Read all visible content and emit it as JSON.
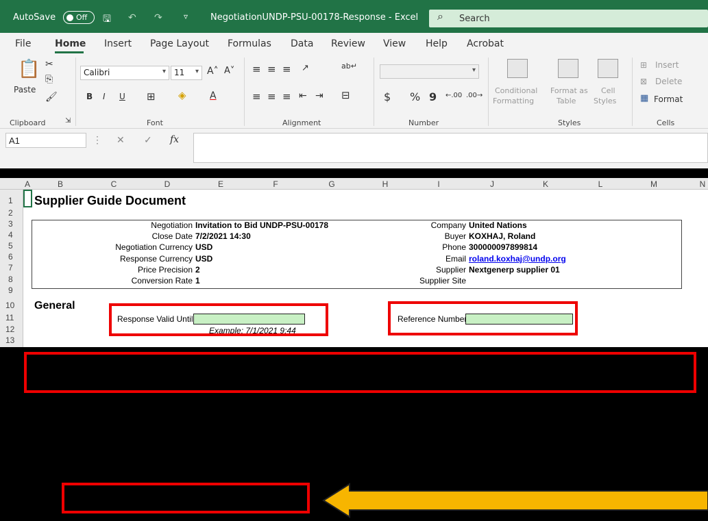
{
  "titlebar": {
    "autosave_label": "AutoSave",
    "autosave_state": "Off",
    "doc_title": "NegotiationUNDP-PSU-00178-Response  -  Excel",
    "search_placeholder": "Search"
  },
  "menu": {
    "tabs": [
      "File",
      "Home",
      "Insert",
      "Page Layout",
      "Formulas",
      "Data",
      "Review",
      "View",
      "Help",
      "Acrobat"
    ],
    "active": "Home"
  },
  "ribbon": {
    "clipboard": {
      "paste": "Paste",
      "label": "Clipboard"
    },
    "font": {
      "name": "Calibri",
      "size": "11",
      "label": "Font",
      "bold": "B",
      "italic": "I",
      "underline": "U"
    },
    "alignment": {
      "label": "Alignment"
    },
    "number": {
      "label": "Number",
      "currency": "$",
      "percent": "%",
      "comma": "9"
    },
    "styles": {
      "label": "Styles",
      "conditional": "Conditional",
      "conditional2": "Formatting",
      "format_as": "Format as",
      "format_as2": "Table",
      "cell": "Cell",
      "cell2": "Styles"
    },
    "cells": {
      "label": "Cells",
      "insert": "Insert",
      "delete": "Delete",
      "format": "Format"
    }
  },
  "formula": {
    "namebox": "A1",
    "fx": "fx"
  },
  "grid": {
    "columns": [
      "A",
      "B",
      "C",
      "D",
      "E",
      "F",
      "G",
      "H",
      "I",
      "J",
      "K",
      "L",
      "M",
      "N"
    ],
    "rows": [
      "1",
      "2",
      "3",
      "4",
      "5",
      "6",
      "7",
      "8",
      "9",
      "10",
      "11",
      "12",
      "13"
    ]
  },
  "sheet": {
    "title": "Supplier Guide Document",
    "left_fields": [
      {
        "label": "Negotiation",
        "value": "Invitation to Bid UNDP-PSU-00178"
      },
      {
        "label": "Close Date",
        "value": "7/2/2021 14:30"
      },
      {
        "label": "Negotiation Currency",
        "value": "USD"
      },
      {
        "label": "Response Currency",
        "value": "USD"
      },
      {
        "label": "Price Precision",
        "value": "2"
      },
      {
        "label": "Conversion Rate",
        "value": "1"
      }
    ],
    "right_fields": [
      {
        "label": "Company",
        "value": "United Nations"
      },
      {
        "label": "Buyer",
        "value": "KOXHAJ, Roland"
      },
      {
        "label": "Phone",
        "value": "300000097899814"
      },
      {
        "label": "Email",
        "value": "roland.koxhaj@undp.org"
      },
      {
        "label": "Supplier",
        "value": "Nextgenerp supplier 01"
      },
      {
        "label": "Supplier Site",
        "value": ""
      }
    ],
    "general": "General",
    "response_valid_until": "Response Valid Until",
    "example": "Example:  7/1/2021 9:44",
    "reference_number": "Reference Number"
  },
  "colors": {
    "excel_green": "#217346",
    "highlight_red": "#e00000",
    "arrow_yellow": "#f7b500"
  }
}
